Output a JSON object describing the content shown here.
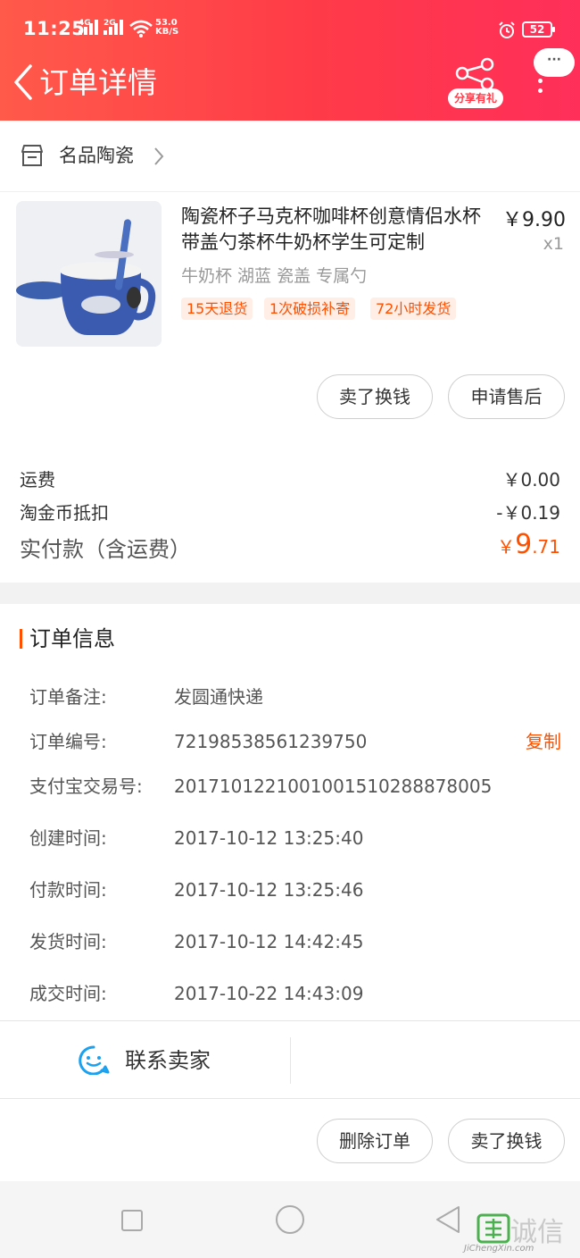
{
  "status_bar": {
    "time": "11:25",
    "net_1": "4G",
    "net_2": "2G",
    "speed_value": "53.0",
    "speed_unit": "KB/S",
    "battery": "52"
  },
  "header": {
    "title": "订单详情",
    "share_label": "分享有礼",
    "more_bubble": "···"
  },
  "shop": {
    "name": "名品陶瓷"
  },
  "product": {
    "title": "陶瓷杯子马克杯咖啡杯创意情侣水杯带盖勺茶杯牛奶杯学生可定制",
    "price": "￥9.90",
    "quantity": "x1",
    "spec": "牛奶杯 湖蓝 瓷盖 专属勺",
    "tags": [
      "15天退货",
      "1次破损补寄",
      "72小时发货"
    ],
    "sell_button": "卖了换钱",
    "after_sale_button": "申请售后"
  },
  "fees": {
    "shipping_label": "运费",
    "shipping_value": "￥0.00",
    "coin_label": "淘金币抵扣",
    "coin_value": "-￥0.19",
    "paid_label": "实付款（含运费）",
    "paid_currency": "￥",
    "paid_int": "9",
    "paid_dec": ".71"
  },
  "order_info": {
    "title": "订单信息",
    "rows": [
      {
        "label": "订单备注:",
        "value": "发圆通快递"
      },
      {
        "label": "订单编号:",
        "value": "72198538561239750"
      },
      {
        "label": "支付宝交易号:",
        "value": "2017101221001001510288878005"
      },
      {
        "label": "创建时间:",
        "value": "2017-10-12 13:25:40"
      },
      {
        "label": "付款时间:",
        "value": "2017-10-12 13:25:46"
      },
      {
        "label": "发货时间:",
        "value": "2017-10-12 14:42:45"
      },
      {
        "label": "成交时间:",
        "value": "2017-10-22 14:43:09"
      }
    ],
    "copy_label": "复制"
  },
  "contact": {
    "label": "联系卖家"
  },
  "bottom_actions": {
    "delete_label": "删除订单",
    "sell_label": "卖了换钱"
  },
  "watermark": {
    "text": "诚信",
    "domain": "JiChengXin.com"
  },
  "colors": {
    "header_start": "#ff5a4a",
    "header_end": "#ff2f5a",
    "accent": "#ff5000"
  }
}
